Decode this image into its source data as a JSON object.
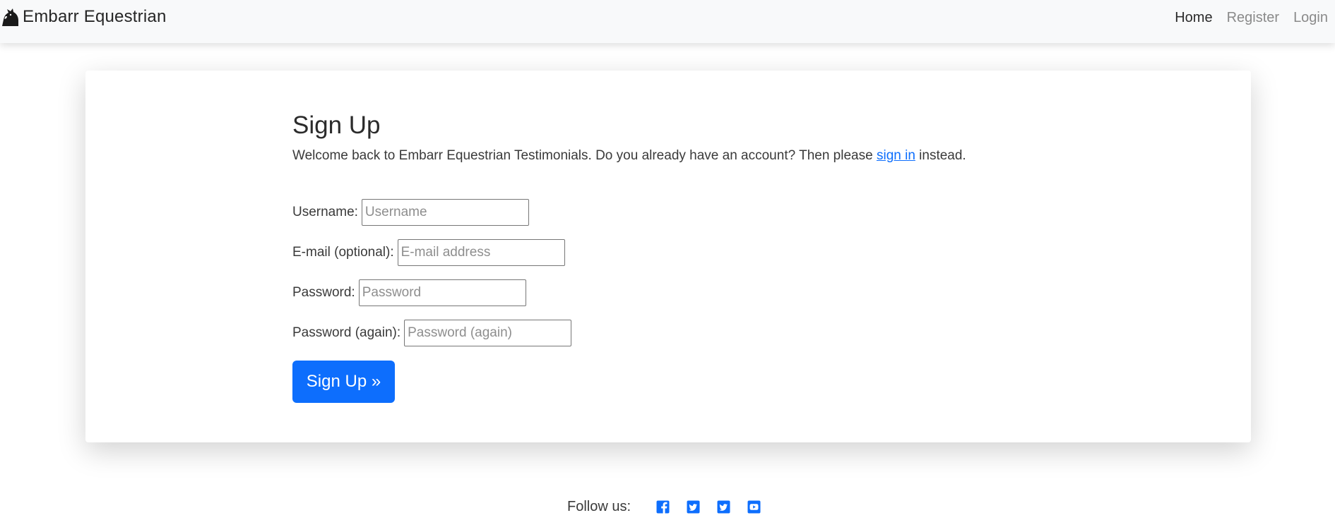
{
  "navbar": {
    "brand": "Embarr Equestrian",
    "brand_icon": "horse-head-icon",
    "links": [
      {
        "label": "Home",
        "active": true
      },
      {
        "label": "Register",
        "active": false
      },
      {
        "label": "Login",
        "active": false
      }
    ]
  },
  "signup": {
    "title": "Sign Up",
    "intro_before": "Welcome back to Embarr Equestrian Testimonials. Do you already have an account? Then please ",
    "intro_link": "sign in",
    "intro_after": " instead.",
    "fields": [
      {
        "label": "Username:",
        "placeholder": "Username",
        "value": ""
      },
      {
        "label": "E-mail (optional):",
        "placeholder": "E-mail address",
        "value": ""
      },
      {
        "label": "Password:",
        "placeholder": "Password",
        "value": ""
      },
      {
        "label": "Password (again):",
        "placeholder": "Password (again)",
        "value": ""
      }
    ],
    "submit_label": "Sign Up »"
  },
  "footer": {
    "follow_label": "Follow us:",
    "social_icons": [
      "facebook-icon",
      "twitter-icon",
      "twitter-icon",
      "youtube-icon"
    ]
  },
  "colors": {
    "accent": "#0d6efd",
    "navbar_bg": "#f8f9fa",
    "nav_active": "#2b2b2b",
    "nav_inactive": "#8a8a8a"
  }
}
